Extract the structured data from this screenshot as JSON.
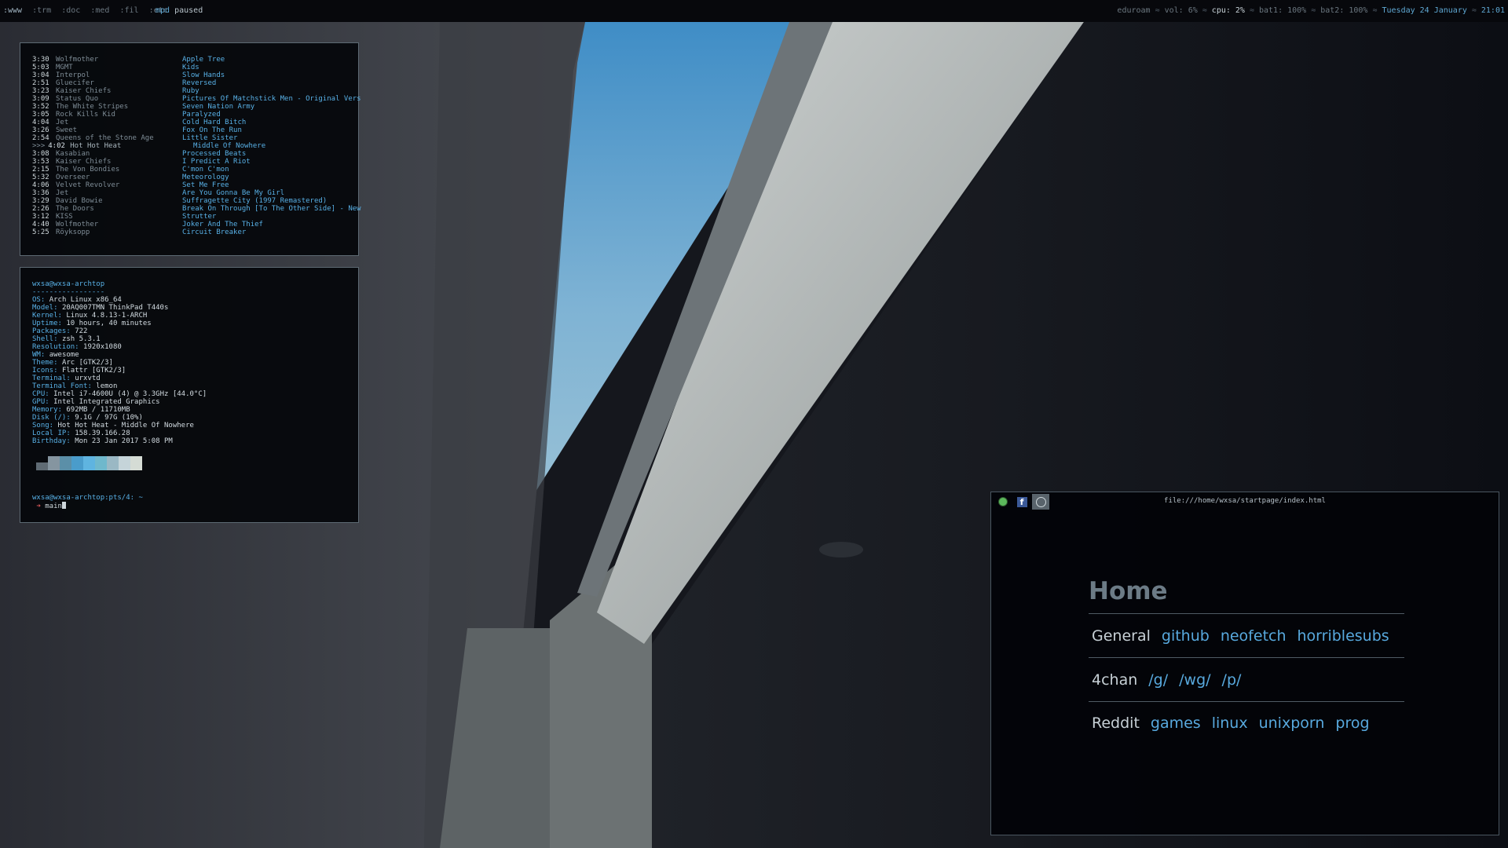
{
  "topbar": {
    "tags": [
      ":www",
      ":trm",
      ":doc",
      ":med",
      ":fil",
      ":etc"
    ],
    "mpd_label": "mpd",
    "mpd_state": "paused",
    "network": "eduroam",
    "volume": "vol: 6%",
    "cpu": "cpu: 2%",
    "bat1": "bat1: 100%",
    "bat2": "bat2: 100%",
    "date": "Tuesday 24 January",
    "time": "21:01"
  },
  "playlist": {
    "current_marker": ">>>",
    "rows": [
      {
        "time": "3:30",
        "artist": "Wolfmother",
        "title": "Apple Tree"
      },
      {
        "time": "5:03",
        "artist": "MGMT",
        "title": "Kids"
      },
      {
        "time": "3:04",
        "artist": "Interpol",
        "title": "Slow Hands"
      },
      {
        "time": "2:51",
        "artist": "Gluecifer",
        "title": "Reversed"
      },
      {
        "time": "3:23",
        "artist": "Kaiser Chiefs",
        "title": "Ruby"
      },
      {
        "time": "3:09",
        "artist": "Status Quo",
        "title": "Pictures Of Matchstick Men - Original Vers"
      },
      {
        "time": "3:52",
        "artist": "The White Stripes",
        "title": "Seven Nation Army"
      },
      {
        "time": "3:05",
        "artist": "Rock Kills Kid",
        "title": "Paralyzed"
      },
      {
        "time": "4:04",
        "artist": "Jet",
        "title": "Cold Hard Bitch"
      },
      {
        "time": "3:26",
        "artist": "Sweet",
        "title": "Fox On The Run"
      },
      {
        "time": "2:54",
        "artist": "Queens of the Stone Age",
        "title": "Little Sister"
      },
      {
        "time": "4:02",
        "artist": "Hot Hot Heat",
        "title": "Middle Of Nowhere"
      },
      {
        "time": "3:08",
        "artist": "Kasabian",
        "title": "Processed Beats"
      },
      {
        "time": "3:53",
        "artist": "Kaiser Chiefs",
        "title": "I Predict A Riot"
      },
      {
        "time": "2:15",
        "artist": "The Von Bondies",
        "title": "C'mon C'mon"
      },
      {
        "time": "5:32",
        "artist": "Overseer",
        "title": "Meteorology"
      },
      {
        "time": "4:06",
        "artist": "Velvet Revolver",
        "title": "Set Me Free"
      },
      {
        "time": "3:36",
        "artist": "Jet",
        "title": "Are You Gonna Be My Girl"
      },
      {
        "time": "3:29",
        "artist": "David Bowie",
        "title": "Suffragette City (1997 Remastered)"
      },
      {
        "time": "2:26",
        "artist": "The Doors",
        "title": "Break On Through [To The Other Side] - New"
      },
      {
        "time": "3:12",
        "artist": "KISS",
        "title": "Strutter"
      },
      {
        "time": "4:40",
        "artist": "Wolfmother",
        "title": "Joker And The Thief"
      },
      {
        "time": "5:25",
        "artist": "Röyksopp",
        "title": "Circuit Breaker"
      }
    ]
  },
  "neofetch": {
    "user_host": "wxsa@wxsa-archtop",
    "rule": "-----------------",
    "info": [
      {
        "key": "OS:",
        "value": "Arch Linux x86_64"
      },
      {
        "key": "Model:",
        "value": "20AQ007TMN ThinkPad T440s"
      },
      {
        "key": "Kernel:",
        "value": "Linux 4.8.13-1-ARCH"
      },
      {
        "key": "Uptime:",
        "value": "10 hours, 40 minutes"
      },
      {
        "key": "Packages:",
        "value": "722"
      },
      {
        "key": "Shell:",
        "value": "zsh 5.3.1"
      },
      {
        "key": "Resolution:",
        "value": "1920x1080"
      },
      {
        "key": "WM:",
        "value": "awesome"
      },
      {
        "key": "Theme:",
        "value": "Arc [GTK2/3]"
      },
      {
        "key": "Icons:",
        "value": "Flattr [GTK2/3]"
      },
      {
        "key": "Terminal:",
        "value": "urxvtd"
      },
      {
        "key": "Terminal Font:",
        "value": "lemon"
      },
      {
        "key": "CPU:",
        "value": "Intel i7-4600U (4) @ 3.3GHz [44.0°C]"
      },
      {
        "key": "GPU:",
        "value": "Intel Integrated Graphics"
      },
      {
        "key": "Memory:",
        "value": "692MB / 11710MB"
      },
      {
        "key": "Disk (/):",
        "value": "9.1G / 97G (10%)"
      },
      {
        "key": "Song:",
        "value": "Hot Hot Heat - Middle Of Nowhere"
      },
      {
        "key": "Local IP:",
        "value": "158.39.166.28"
      },
      {
        "key": "Birthday:",
        "value": "Mon 23 Jan 2017 5:08 PM"
      }
    ],
    "swatch_colors": [
      "#5f6b74",
      "#8595a0",
      "#5b8fa8",
      "#4a9ccb",
      "#5fb4e0",
      "#6fb8cc",
      "#9ab8c4",
      "#c5d4d9",
      "#d5dcd5"
    ],
    "prompt": "wxsa@wxsa-archtop:pts/4: ~",
    "prompt_arrow": "➜",
    "prompt_cmd": "main"
  },
  "browser": {
    "url": "file:///home/wxsa/startpage/index.html",
    "title": "Home",
    "sections": [
      {
        "category": "General",
        "links": [
          "github",
          "neofetch",
          "horriblesubs"
        ]
      },
      {
        "category": "4chan",
        "links": [
          "/g/",
          "/wg/",
          "/p/"
        ]
      },
      {
        "category": "Reddit",
        "links": [
          "games",
          "linux",
          "unixporn",
          "prog"
        ]
      }
    ]
  },
  "colors": {
    "accent": "#58b0e6",
    "link": "#58a9de",
    "border": "#5d6a73"
  }
}
